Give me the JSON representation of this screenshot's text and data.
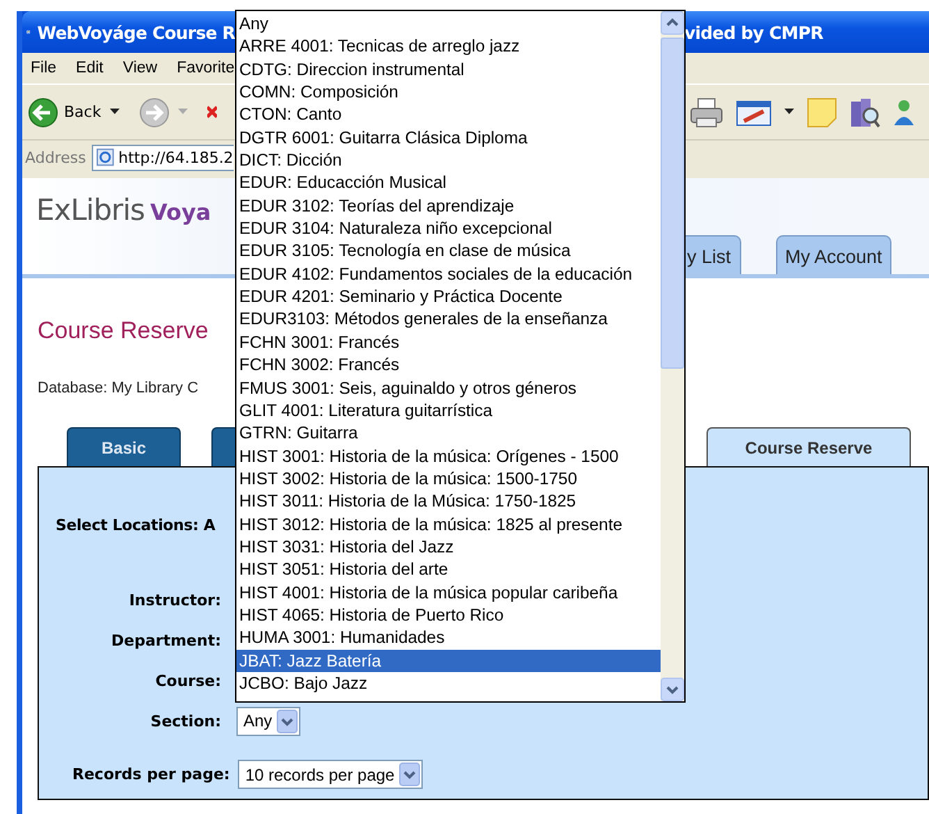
{
  "window": {
    "title_start": "WebVoyáge Course R",
    "title_end": "vided by CMPR"
  },
  "menu": [
    "File",
    "Edit",
    "View",
    "Favorite"
  ],
  "toolbar": {
    "back_label": "Back"
  },
  "address_bar": {
    "label": "Address",
    "url": "http://64.185.2"
  },
  "header": {
    "logo_brand": "ExLibris",
    "logo_product": "Voya",
    "nav_tabs": [
      {
        "label": "y List"
      },
      {
        "label": "My Account"
      }
    ]
  },
  "page_title": "Course Reserve",
  "database": "Database: My Library C",
  "search_tabs": [
    {
      "label": "Basic",
      "selected": false
    },
    {
      "selected": false
    },
    {
      "label": "Course Reserve",
      "selected": true
    }
  ],
  "form": {
    "locations_label": "Select Locations: A",
    "fields": [
      {
        "label": "Instructor:",
        "kind": "covered"
      },
      {
        "label": "Department:",
        "kind": "covered"
      },
      {
        "label": "Course:",
        "kind": "covered"
      },
      {
        "label": "Section:",
        "kind": "select",
        "value": "Any"
      }
    ],
    "records_label": "Records per page:",
    "records_value": "10 records per page"
  },
  "dropdown": {
    "options": [
      {
        "label": "Any",
        "selected": false
      },
      {
        "label": "ARRE 4001: Tecnicas de arreglo jazz",
        "selected": false
      },
      {
        "label": "CDTG: Direccion instrumental",
        "selected": false
      },
      {
        "label": "COMN: Composición",
        "selected": false
      },
      {
        "label": "CTON: Canto",
        "selected": false
      },
      {
        "label": "DGTR 6001: Guitarra Clásica Diploma",
        "selected": false
      },
      {
        "label": "DICT: Dicción",
        "selected": false
      },
      {
        "label": "EDUR: Educacción Musical",
        "selected": false
      },
      {
        "label": "EDUR 3102: Teorías del aprendizaje",
        "selected": false
      },
      {
        "label": "EDUR 3104: Naturaleza niño excepcional",
        "selected": false
      },
      {
        "label": "EDUR 3105: Tecnología en clase de música",
        "selected": false
      },
      {
        "label": "EDUR 4102: Fundamentos sociales de la educación",
        "selected": false
      },
      {
        "label": "EDUR 4201: Seminario y Práctica Docente",
        "selected": false
      },
      {
        "label": "EDUR3103: Métodos generales de la enseñanza",
        "selected": false
      },
      {
        "label": "FCHN 3001: Francés",
        "selected": false
      },
      {
        "label": "FCHN 3002: Francés",
        "selected": false
      },
      {
        "label": "FMUS 3001: Seis, aguinaldo y otros géneros",
        "selected": false
      },
      {
        "label": "GLIT 4001: Literatura guitarrística",
        "selected": false
      },
      {
        "label": "GTRN: Guitarra",
        "selected": false
      },
      {
        "label": "HIST 3001: Historia de la música: Orígenes - 1500",
        "selected": false
      },
      {
        "label": "HIST 3002: Historia de la música: 1500-1750",
        "selected": false
      },
      {
        "label": "HIST 3011: Historia de la Música: 1750-1825",
        "selected": false
      },
      {
        "label": "HIST 3012: Historia de la música: 1825 al presente",
        "selected": false
      },
      {
        "label": "HIST 3031: Historia del Jazz",
        "selected": false
      },
      {
        "label": "HIST 3051: Historia del arte",
        "selected": false
      },
      {
        "label": "HIST 4001: Historia de la música popular caribeña",
        "selected": false
      },
      {
        "label": "HIST 4065: Historia de Puerto Rico",
        "selected": false
      },
      {
        "label": "HUMA 3001: Humanidades",
        "selected": false
      },
      {
        "label": "JBAT: Jazz Batería",
        "selected": true
      },
      {
        "label": "JCBO: Bajo Jazz",
        "selected": false
      }
    ]
  }
}
